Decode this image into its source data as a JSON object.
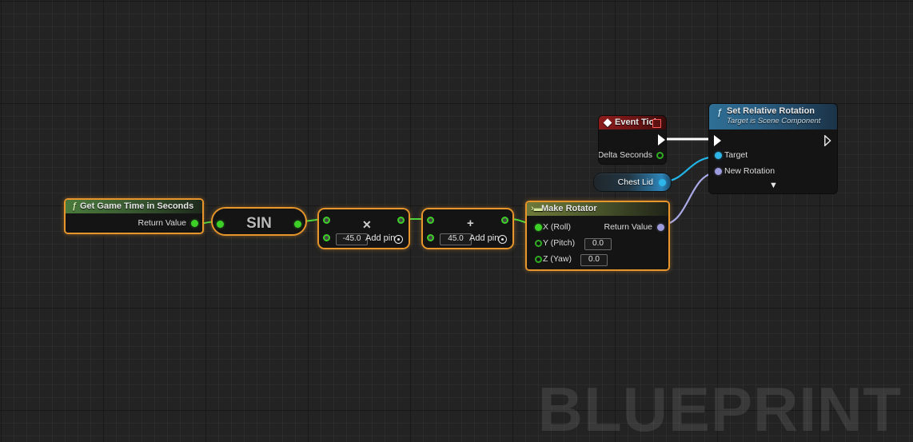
{
  "canvas": {
    "watermark": "BLUEPRINT",
    "background_color": "#232323",
    "grid_minor_color": "#2b2b2b",
    "grid_major_color": "#141414",
    "selection_color": "#e8962c"
  },
  "nodes": {
    "get_game_time": {
      "title": "Get Game Time in Seconds",
      "icon": "function-f-icon",
      "output_label": "Return Value",
      "selected": true
    },
    "sin": {
      "title": "SIN",
      "selected": true
    },
    "multiply": {
      "operator": "✕",
      "operator_name": "multiply",
      "value": "-45.0",
      "add_pin_label": "Add pin",
      "selected": true
    },
    "add": {
      "operator": "+",
      "operator_name": "add",
      "value": "45.0",
      "add_pin_label": "Add pin",
      "selected": true
    },
    "make_rotator": {
      "title": "Make Rotator",
      "icon": "make-struct-icon",
      "inputs": [
        {
          "label": "X (Roll)",
          "value": null,
          "connected": true
        },
        {
          "label": "Y (Pitch)",
          "value": "0.0",
          "connected": false
        },
        {
          "label": "Z (Yaw)",
          "value": "0.0",
          "connected": false
        }
      ],
      "output_label": "Return Value",
      "selected": true
    },
    "event_tick": {
      "title": "Event Tick",
      "icon": "event-diamond-icon",
      "stop_icon": "stop-square-icon",
      "output_label": "Delta Seconds",
      "selected": false
    },
    "chest_lid": {
      "title": "Chest Lid",
      "selected": false
    },
    "set_relative_rotation": {
      "title": "Set Relative Rotation",
      "subtitle": "Target is Scene Component",
      "icon": "function-f-icon",
      "inputs": [
        {
          "label": "Target",
          "pin_type": "object"
        },
        {
          "label": "New Rotation",
          "pin_type": "rotator"
        }
      ],
      "collapse_icon": "chevron-down-icon",
      "selected": false
    }
  },
  "wires": {
    "exec_color": "#ffffff",
    "float_color": "#4cd63a",
    "object_color": "#22b5e8",
    "rotator_color": "#a9a9e6"
  }
}
